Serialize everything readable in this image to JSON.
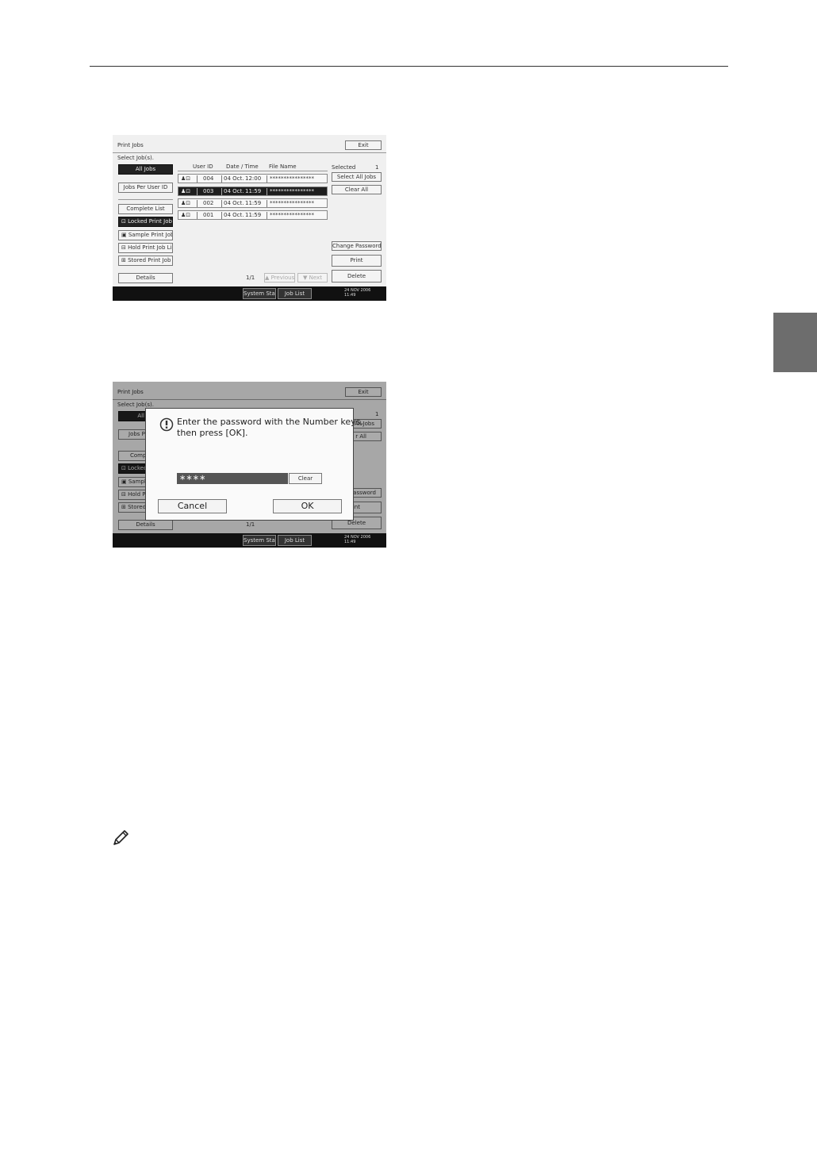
{
  "screen1": {
    "title": "Print Jobs",
    "exit": "Exit",
    "select_prompt": "Select Job(s).",
    "left_buttons": [
      "All Jobs",
      "Jobs Per User ID",
      "Complete List",
      "Locked Print Job List",
      "Sample Print Job List",
      "Hold Print Job List",
      "Stored Print Job List"
    ],
    "details": "Details",
    "columns": [
      "User ID",
      "Date / Time",
      "File Name"
    ],
    "rows": [
      {
        "user": "004",
        "date": "04 Oct.",
        "time": "12:00",
        "file": "****************"
      },
      {
        "user": "003",
        "date": "04 Oct.",
        "time": "11:59",
        "file": "****************"
      },
      {
        "user": "002",
        "date": "04 Oct.",
        "time": "11:59",
        "file": "****************"
      },
      {
        "user": "001",
        "date": "04 Oct.",
        "time": "11:59",
        "file": "****************"
      }
    ],
    "selected_label": "Selected",
    "selected_count": "1",
    "select_all": "Select All Jobs",
    "clear_all": "Clear All",
    "change_password": "Change Password",
    "print": "Print",
    "delete": "Delete",
    "page": "1/1",
    "previous": "▲ Previous",
    "next": "▼ Next",
    "system_status": "System Status",
    "job_list": "Job List",
    "clock_date": "24 NOV 2006",
    "clock_time": "11:49"
  },
  "screen2": {
    "bg_title": "Print Jobs",
    "bg_exit": "Exit",
    "bg_select": "Select Job(s).",
    "bg_all": "All",
    "bg_jobs_per": "Jobs Pe",
    "bg_complete": "Compl",
    "bg_locked": "Locked Pr",
    "bg_sample": "Sample Pr",
    "bg_hold": "Hold Print",
    "bg_stored": "Stored Pri",
    "bg_details": "Details",
    "bg_page": "1/1",
    "bg_count": "1",
    "bg_all_jobs": "All Jobs",
    "bg_clear_all": "r All",
    "bg_password": "Password",
    "bg_print": "int",
    "bg_delete": "Delete",
    "prompt_line1": "Enter the password with the Number keys,",
    "prompt_line2": "then press [OK].",
    "password_value": "∗∗∗∗",
    "clear": "Clear",
    "cancel": "Cancel",
    "ok": "OK",
    "system_status": "System Status",
    "job_list": "Job List",
    "clock_date": "24 NOV 2006",
    "clock_time": "11:49"
  },
  "icons": {
    "note": "pencil-icon",
    "lock": "lock-icon",
    "person": "person-icon",
    "alert": "alert-icon"
  }
}
